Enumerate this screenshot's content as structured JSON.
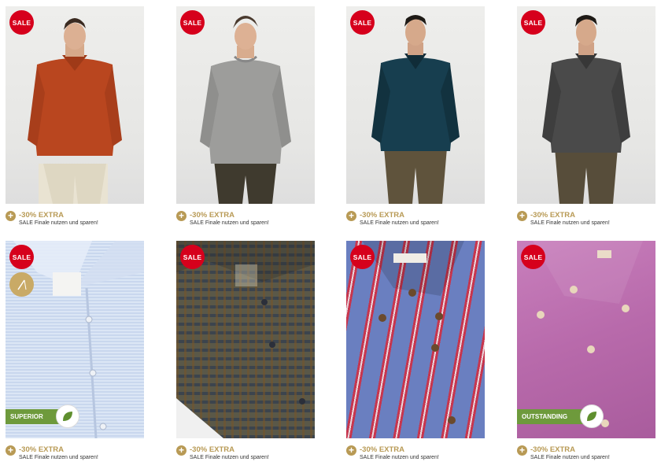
{
  "products": [
    {
      "sale_label": "SALE",
      "promo_title": "-30% EXTRA",
      "promo_sub": "SALE Finale nutzen und sparen!"
    },
    {
      "sale_label": "SALE",
      "promo_title": "-30% EXTRA",
      "promo_sub": "SALE Finale nutzen und sparen!"
    },
    {
      "sale_label": "SALE",
      "promo_title": "-30% EXTRA",
      "promo_sub": "SALE Finale nutzen und sparen!"
    },
    {
      "sale_label": "SALE",
      "promo_title": "-30% EXTRA",
      "promo_sub": "SALE Finale nutzen und sparen!"
    },
    {
      "sale_label": "SALE",
      "promo_title": "-30% EXTRA",
      "promo_sub": "SALE Finale nutzen und sparen!",
      "badge": "SUPERIOR"
    },
    {
      "sale_label": "SALE",
      "promo_title": "-30% EXTRA",
      "promo_sub": "SALE Finale nutzen und sparen!"
    },
    {
      "sale_label": "SALE",
      "promo_title": "-30% EXTRA",
      "promo_sub": "SALE Finale nutzen und sparen!"
    },
    {
      "sale_label": "SALE",
      "promo_title": "-30% EXTRA",
      "promo_sub": "SALE Finale nutzen und sparen!",
      "badge": "OUTSTANDING"
    }
  ],
  "colors": {
    "sale": "#d6001c",
    "promo": "#b89a55",
    "badge": "#6e9a3c"
  },
  "icons": {
    "promo_toggle": "plus-icon",
    "badge_icon": "leaf-icon",
    "quality_icon": "needle-icon"
  }
}
